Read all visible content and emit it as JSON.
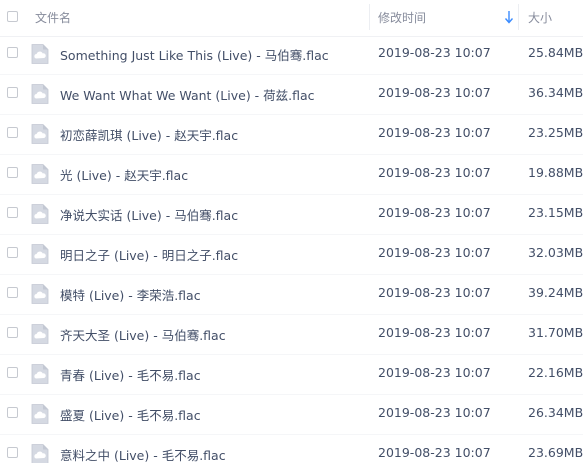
{
  "header": {
    "name_label": "文件名",
    "modified_label": "修改时间",
    "size_label": "大小",
    "sort_icon": "arrow-down-icon"
  },
  "file_icon": "cloud-file-icon",
  "accent_color": "#3b8cff",
  "files": [
    {
      "name": "Something Just Like This (Live) - 马伯骞.flac",
      "modified": "2019-08-23 10:07",
      "size": "25.84MB"
    },
    {
      "name": "We Want What We Want (Live) - 荷兹.flac",
      "modified": "2019-08-23 10:07",
      "size": "36.34MB"
    },
    {
      "name": "初恋薛凯琪 (Live) - 赵天宇.flac",
      "modified": "2019-08-23 10:07",
      "size": "23.25MB"
    },
    {
      "name": "光 (Live) - 赵天宇.flac",
      "modified": "2019-08-23 10:07",
      "size": "19.88MB"
    },
    {
      "name": "净说大实话 (Live) - 马伯骞.flac",
      "modified": "2019-08-23 10:07",
      "size": "23.15MB"
    },
    {
      "name": "明日之子 (Live) - 明日之子.flac",
      "modified": "2019-08-23 10:07",
      "size": "32.03MB"
    },
    {
      "name": "模特 (Live) - 李荣浩.flac",
      "modified": "2019-08-23 10:07",
      "size": "39.24MB"
    },
    {
      "name": "齐天大圣 (Live) - 马伯骞.flac",
      "modified": "2019-08-23 10:07",
      "size": "31.70MB"
    },
    {
      "name": "青春 (Live) - 毛不易.flac",
      "modified": "2019-08-23 10:07",
      "size": "22.16MB"
    },
    {
      "name": "盛夏 (Live) - 毛不易.flac",
      "modified": "2019-08-23 10:07",
      "size": "26.34MB"
    },
    {
      "name": "意料之中 (Live) - 毛不易.flac",
      "modified": "2019-08-23 10:07",
      "size": "23.69MB"
    }
  ]
}
